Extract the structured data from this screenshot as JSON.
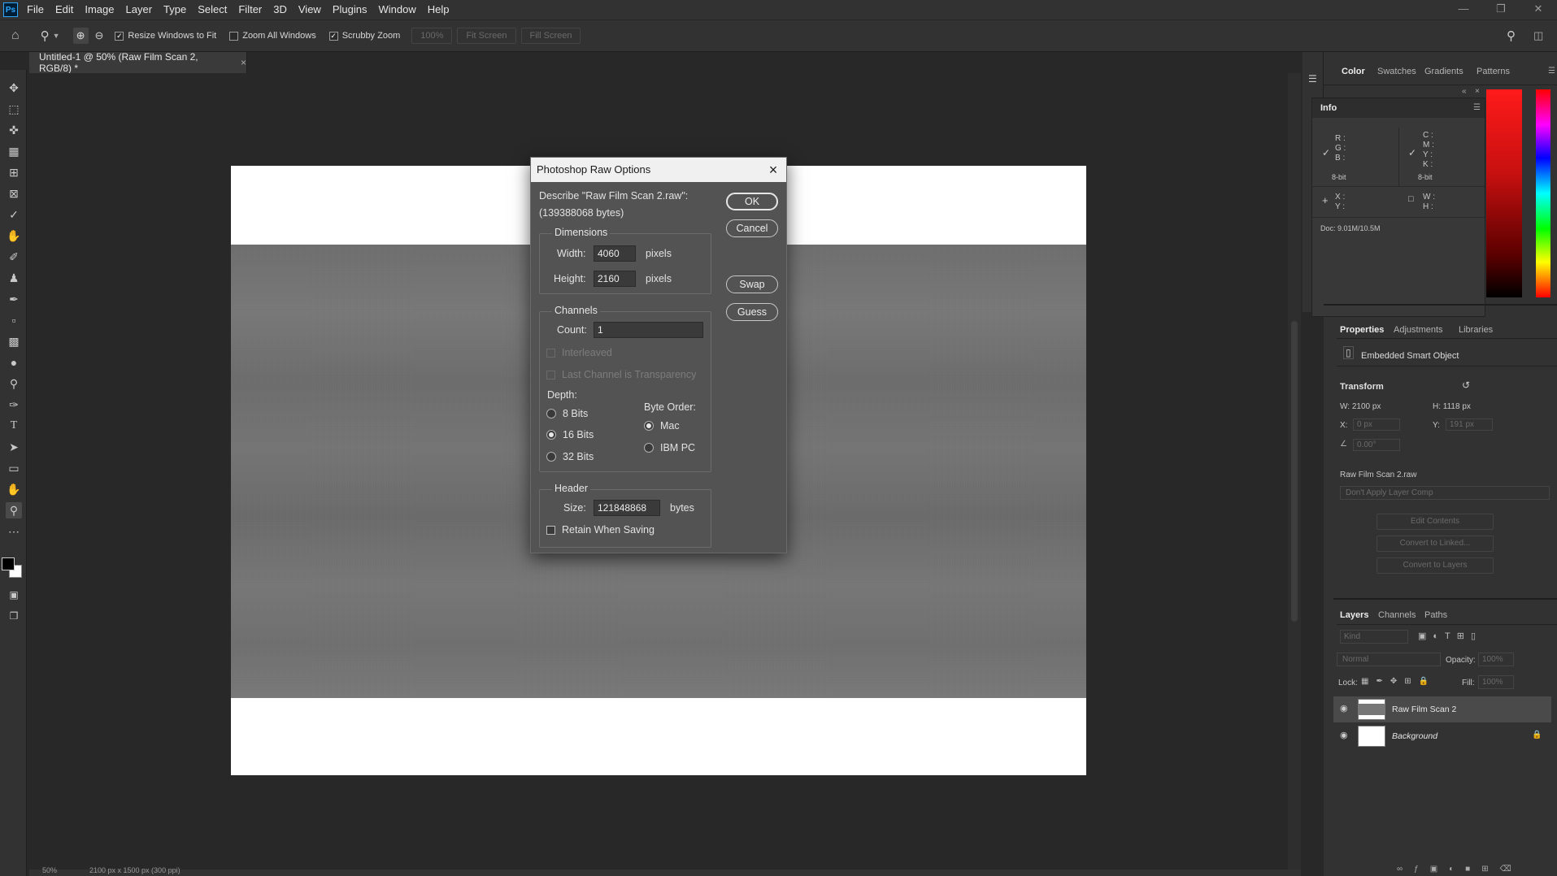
{
  "app": {
    "logo": "Ps"
  },
  "menu": [
    "File",
    "Edit",
    "Image",
    "Layer",
    "Type",
    "Select",
    "Filter",
    "3D",
    "View",
    "Plugins",
    "Window",
    "Help"
  ],
  "options": {
    "resize_windows": "Resize Windows to Fit",
    "zoom_all": "Zoom All Windows",
    "scrubby": "Scrubby Zoom",
    "zoom_value": "100%",
    "fit_screen": "Fit Screen",
    "fill_screen": "Fill Screen"
  },
  "document_tab": {
    "title": "Untitled-1 @ 50% (Raw Film Scan 2, RGB/8) *"
  },
  "status": {
    "zoom": "50%",
    "size": "2100 px x 1500 px (300 ppi)"
  },
  "dialog": {
    "title": "Photoshop Raw Options",
    "describe": "Describe \"Raw Film Scan 2.raw\":",
    "bytes": "(139388068 bytes)",
    "dimensions": {
      "label": "Dimensions",
      "width_label": "Width:",
      "width": "4060",
      "height_label": "Height:",
      "height": "2160",
      "unit": "pixels"
    },
    "channels": {
      "label": "Channels",
      "count_label": "Count:",
      "count": "1",
      "interleaved": "Interleaved",
      "last_transparency": "Last Channel is Transparency"
    },
    "depth": {
      "label": "Depth:",
      "options": [
        "8 Bits",
        "16 Bits",
        "32 Bits"
      ],
      "selected": "16 Bits"
    },
    "byte_order": {
      "label": "Byte Order:",
      "options": [
        "Mac",
        "IBM PC"
      ],
      "selected": "Mac"
    },
    "header": {
      "label": "Header",
      "size_label": "Size:",
      "size": "121848868",
      "unit": "bytes",
      "retain": "Retain When Saving"
    },
    "buttons": {
      "ok": "OK",
      "cancel": "Cancel",
      "swap": "Swap",
      "guess": "Guess"
    }
  },
  "color_panel": {
    "tabs": [
      "Color",
      "Swatches",
      "Gradients",
      "Patterns"
    ]
  },
  "info_panel": {
    "tab": "Info",
    "rgb": [
      "R :",
      "G :",
      "B :"
    ],
    "cmyk": [
      "C :",
      "M :",
      "Y :",
      "K :"
    ],
    "bit_left": "8-bit",
    "bit_right": "8-bit",
    "xy": [
      "X :",
      "Y :"
    ],
    "wh": [
      "W :",
      "H :"
    ],
    "doc": "Doc: 9.01M/10.5M"
  },
  "properties": {
    "tabs": [
      "Properties",
      "Adjustments",
      "Libraries"
    ],
    "kind": "Embedded Smart Object",
    "transform": "Transform",
    "w": "W:  2100 px",
    "h": "H:  1118 px",
    "x_label": "X:",
    "x_val": "0 px",
    "y_label": "Y:",
    "y_val": "191 px",
    "angle": "0.00°",
    "source": "Raw Film Scan 2.raw",
    "layer_comp": "Don't Apply Layer Comp",
    "edit": "Edit Contents",
    "convert_linked": "Convert to Linked...",
    "convert_layers": "Convert to Layers"
  },
  "layers": {
    "tabs": [
      "Layers",
      "Channels",
      "Paths"
    ],
    "kind": "Kind",
    "blend": "Normal",
    "opacity_label": "Opacity:",
    "opacity": "100%",
    "lock_label": "Lock:",
    "fill_label": "Fill:",
    "fill": "100%",
    "items": [
      "Raw Film Scan 2",
      "Background"
    ]
  }
}
